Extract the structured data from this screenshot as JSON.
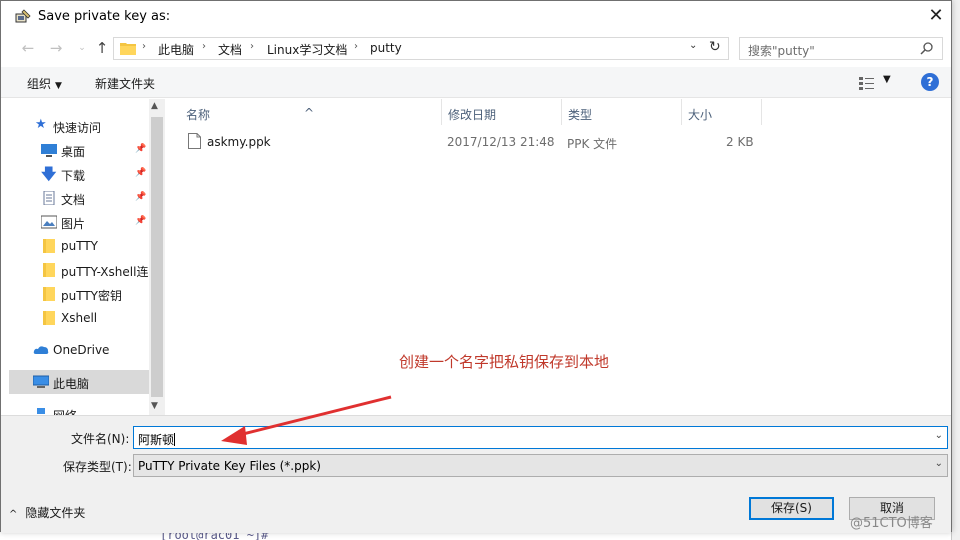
{
  "window": {
    "title": "Save private key as:",
    "close_glyph": "✕"
  },
  "address": {
    "crumbs": [
      "此电脑",
      "文档",
      "Linux学习文档",
      "putty"
    ],
    "search_placeholder": "搜索\"putty\""
  },
  "toolbar": {
    "organize": "组织",
    "new_folder": "新建文件夹",
    "help": "?"
  },
  "navigation": {
    "items": [
      {
        "label": "快速访问",
        "icon": "star-icon"
      },
      {
        "label": "桌面",
        "icon": "desktop-icon",
        "pinned": true
      },
      {
        "label": "下载",
        "icon": "download-icon",
        "pinned": true
      },
      {
        "label": "文档",
        "icon": "document-icon",
        "pinned": true
      },
      {
        "label": "图片",
        "icon": "picture-icon",
        "pinned": true
      },
      {
        "label": "puTTY",
        "icon": "folder-icon"
      },
      {
        "label": "puTTY-Xshell连",
        "icon": "folder-icon"
      },
      {
        "label": "puTTY密钥",
        "icon": "folder-icon"
      },
      {
        "label": "Xshell",
        "icon": "folder-icon"
      },
      {
        "label": "OneDrive",
        "icon": "cloud-icon"
      },
      {
        "label": "此电脑",
        "icon": "computer-icon",
        "selected": true
      },
      {
        "label": "网络",
        "icon": "network-icon"
      }
    ]
  },
  "filelist": {
    "columns": [
      "名称",
      "修改日期",
      "类型",
      "大小"
    ],
    "files": [
      {
        "name": "askmy.ppk",
        "modified": "2017/12/13 21:48",
        "type": "PPK 文件",
        "size": "2 KB"
      }
    ]
  },
  "annotation": {
    "text": "创建一个名字把私钥保存到本地",
    "color": "#c0392b"
  },
  "form": {
    "filename_label": "文件名(N):",
    "filename_value": "阿斯顿",
    "filetype_label": "保存类型(T):",
    "filetype_value": "PuTTY Private Key Files (*.ppk)",
    "hide_folders": "隐藏文件夹",
    "save_button": "保存(S)",
    "cancel_button": "取消"
  },
  "watermark": "@51CTO博客",
  "background_text": "[root@rac01 ~]# "
}
